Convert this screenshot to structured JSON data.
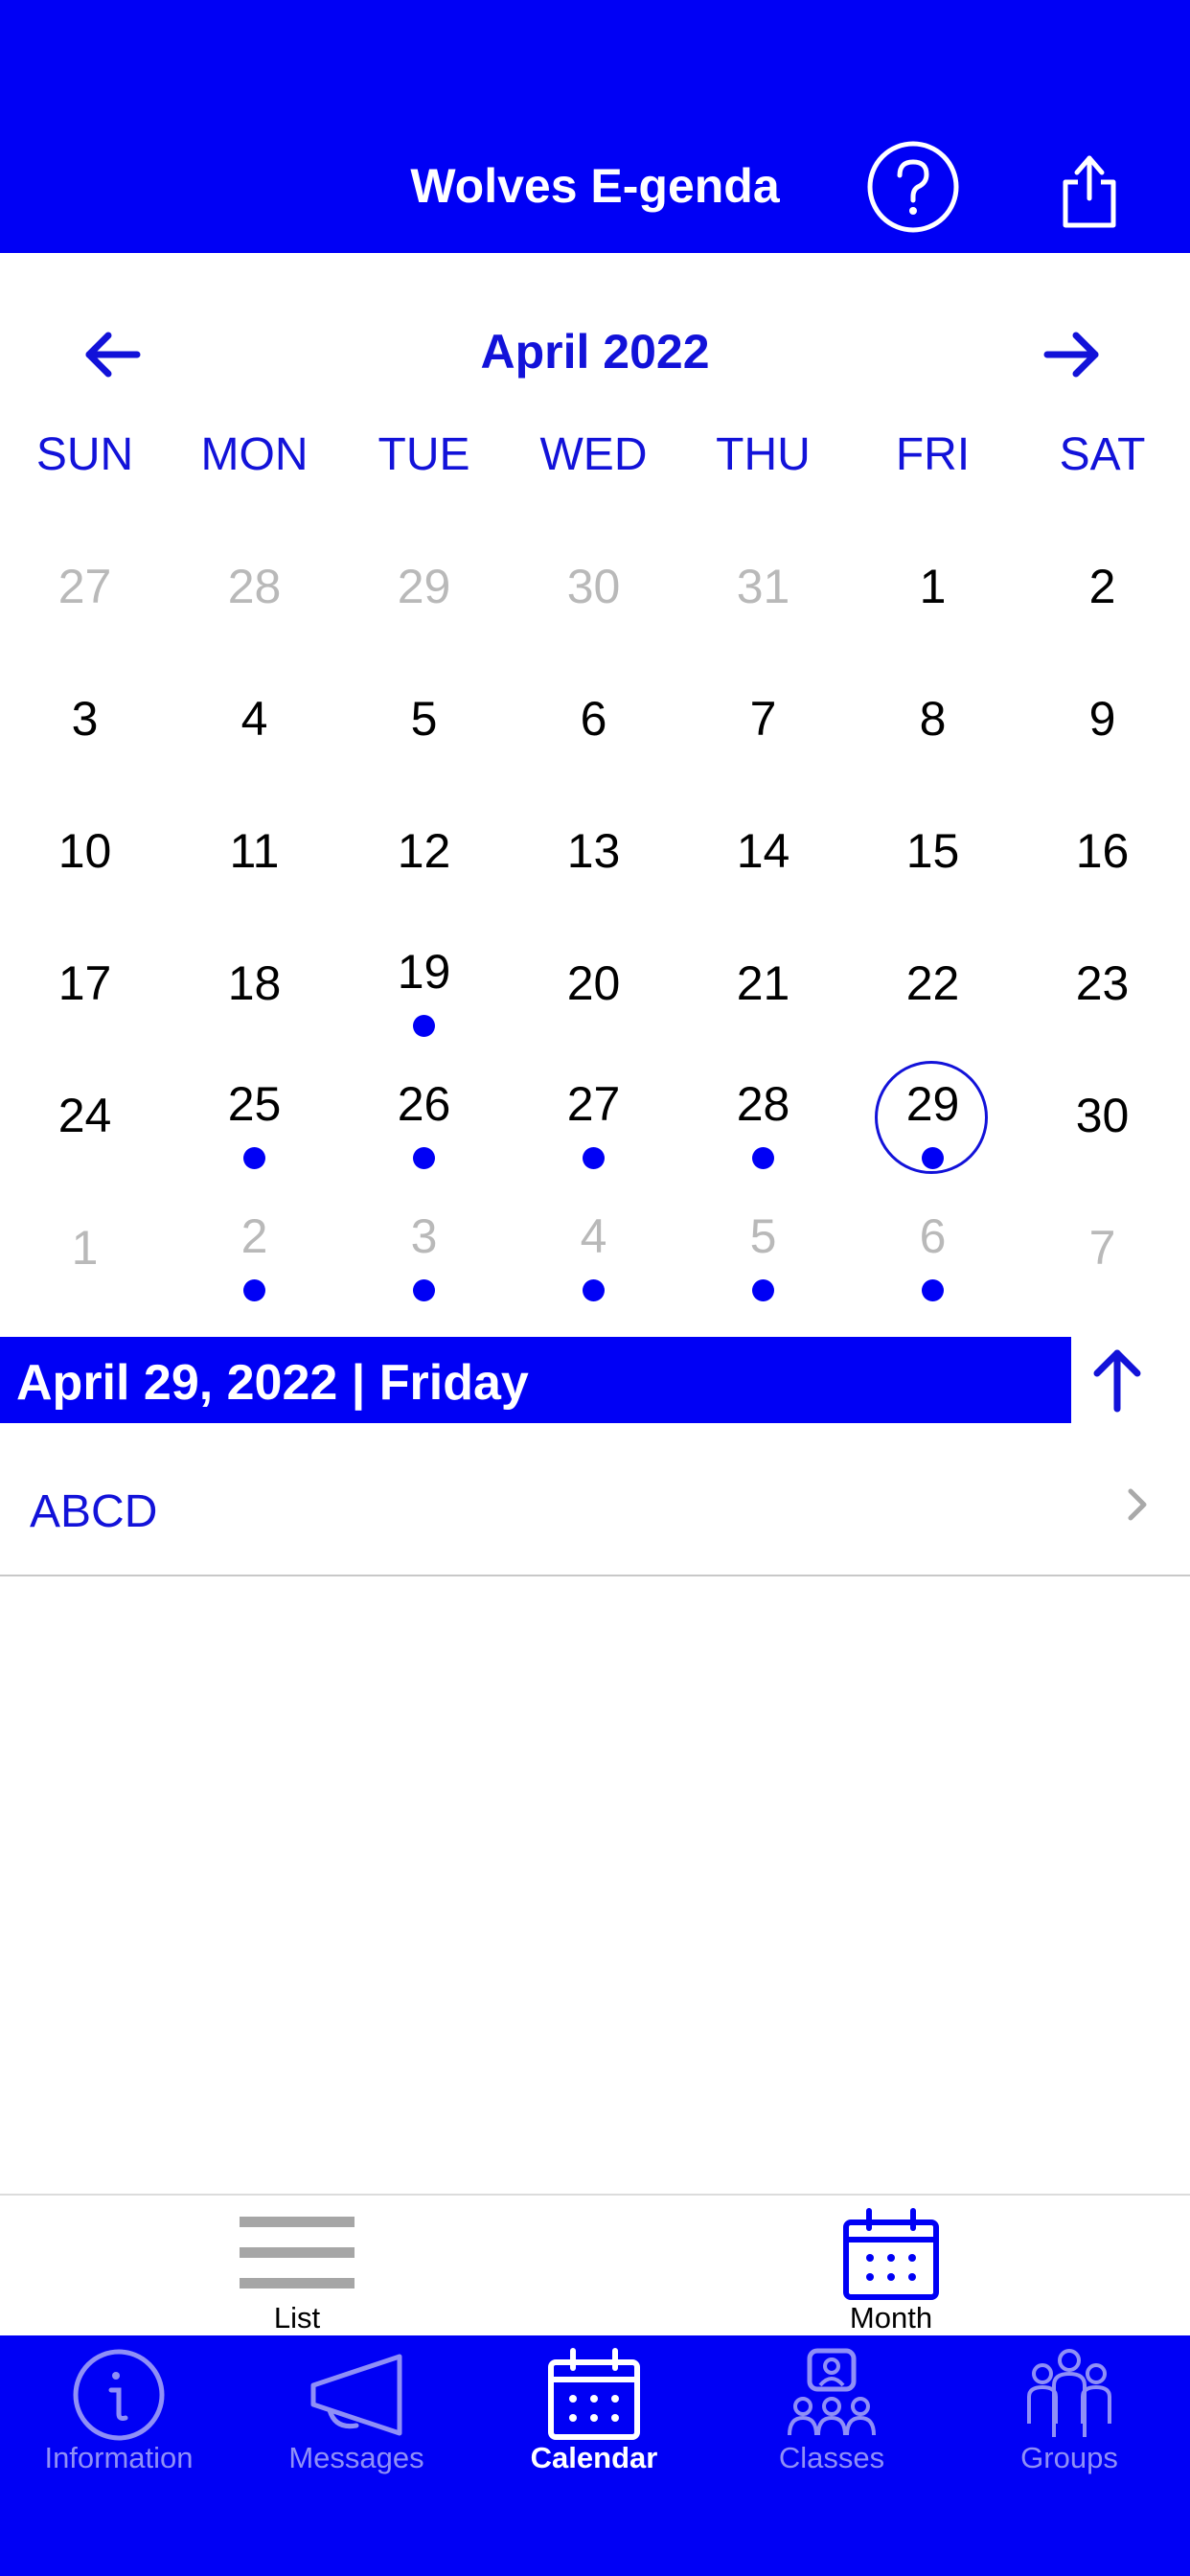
{
  "colors": {
    "brand": "#0000f5",
    "accent_text": "#1212d9",
    "muted_day": "#b9b9b9",
    "inactive_tab": "#8f8ff6"
  },
  "header": {
    "title": "Wolves E-genda",
    "help_icon": "question-circle-icon",
    "share_icon": "share-icon"
  },
  "calendar": {
    "month_title": "April 2022",
    "prev_icon": "arrow-left-icon",
    "next_icon": "arrow-right-icon",
    "weekdays": [
      "SUN",
      "MON",
      "TUE",
      "WED",
      "THU",
      "FRI",
      "SAT"
    ],
    "weeks": [
      [
        {
          "day": "27",
          "muted": true
        },
        {
          "day": "28",
          "muted": true
        },
        {
          "day": "29",
          "muted": true
        },
        {
          "day": "30",
          "muted": true
        },
        {
          "day": "31",
          "muted": true
        },
        {
          "day": "1"
        },
        {
          "day": "2"
        }
      ],
      [
        {
          "day": "3"
        },
        {
          "day": "4"
        },
        {
          "day": "5"
        },
        {
          "day": "6"
        },
        {
          "day": "7"
        },
        {
          "day": "8"
        },
        {
          "day": "9"
        }
      ],
      [
        {
          "day": "10"
        },
        {
          "day": "11"
        },
        {
          "day": "12"
        },
        {
          "day": "13"
        },
        {
          "day": "14"
        },
        {
          "day": "15"
        },
        {
          "day": "16"
        }
      ],
      [
        {
          "day": "17"
        },
        {
          "day": "18"
        },
        {
          "day": "19",
          "event": true
        },
        {
          "day": "20"
        },
        {
          "day": "21"
        },
        {
          "day": "22"
        },
        {
          "day": "23"
        }
      ],
      [
        {
          "day": "24"
        },
        {
          "day": "25",
          "event": true
        },
        {
          "day": "26",
          "event": true
        },
        {
          "day": "27",
          "event": true
        },
        {
          "day": "28",
          "event": true
        },
        {
          "day": "29",
          "event": true,
          "selected": true
        },
        {
          "day": "30"
        }
      ],
      [
        {
          "day": "1",
          "muted": true
        },
        {
          "day": "2",
          "muted": true,
          "event": true
        },
        {
          "day": "3",
          "muted": true,
          "event": true
        },
        {
          "day": "4",
          "muted": true,
          "event": true
        },
        {
          "day": "5",
          "muted": true,
          "event": true
        },
        {
          "day": "6",
          "muted": true,
          "event": true
        },
        {
          "day": "7",
          "muted": true
        }
      ]
    ]
  },
  "selected_date": {
    "label": "April 29, 2022 | Friday",
    "collapse_icon": "arrow-up-icon"
  },
  "events": [
    {
      "title": "ABCD",
      "icon": "chevron-right-icon"
    }
  ],
  "view_toggle": {
    "list_label": "List",
    "month_label": "Month",
    "active": "Month"
  },
  "tabs": [
    {
      "label": "Information",
      "icon": "info-icon",
      "active": false
    },
    {
      "label": "Messages",
      "icon": "megaphone-icon",
      "active": false
    },
    {
      "label": "Calendar",
      "icon": "calendar-icon",
      "active": true
    },
    {
      "label": "Classes",
      "icon": "classes-icon",
      "active": false
    },
    {
      "label": "Groups",
      "icon": "groups-icon",
      "active": false
    }
  ]
}
